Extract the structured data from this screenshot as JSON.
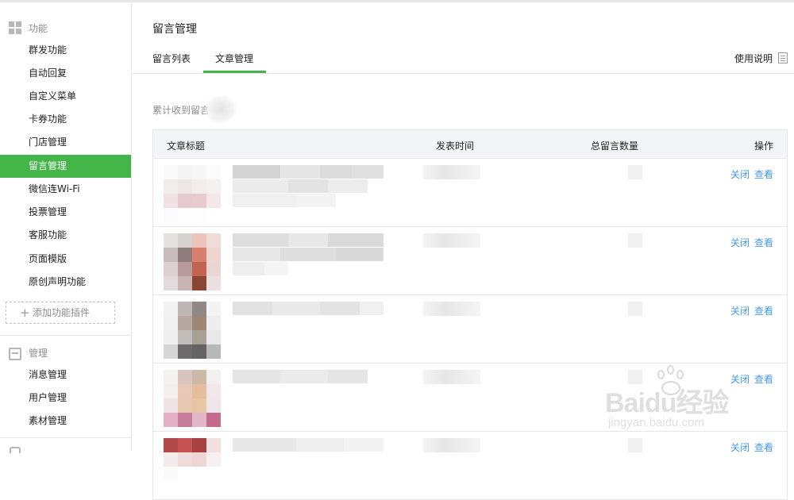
{
  "sidebar": {
    "function_section": {
      "label": "功能",
      "icon": "grid-icon",
      "items": [
        {
          "label": "群发功能"
        },
        {
          "label": "自动回复"
        },
        {
          "label": "自定义菜单"
        },
        {
          "label": "卡券功能"
        },
        {
          "label": "门店管理"
        },
        {
          "label": "留言管理",
          "active": true
        },
        {
          "label": "微信连Wi-Fi"
        },
        {
          "label": "投票管理"
        },
        {
          "label": "客服功能"
        },
        {
          "label": "页面模版"
        },
        {
          "label": "原创声明功能"
        }
      ],
      "add_plugin": {
        "label": "添加功能插件",
        "icon": "plus-icon"
      }
    },
    "manage_section": {
      "label": "管理",
      "icon": "tray-icon",
      "items": [
        {
          "label": "消息管理"
        },
        {
          "label": "用户管理"
        },
        {
          "label": "素材管理"
        }
      ]
    }
  },
  "main": {
    "title": "留言管理",
    "tabs": [
      {
        "label": "留言列表",
        "active": false
      },
      {
        "label": "文章管理",
        "active": true
      }
    ],
    "help": {
      "label": "使用说明",
      "icon": "doc-icon"
    },
    "summary": "累计收到留言",
    "table": {
      "columns": [
        "文章标题",
        "发表时间",
        "总留言数量",
        "操作"
      ],
      "row_actions": {
        "close": "关闭",
        "view": "查看"
      },
      "row_count": 5
    }
  },
  "colors": {
    "accent": "#44b549",
    "link": "#459ae9",
    "border": "#e7e7eb",
    "table_header_bg": "#f4f5f9"
  },
  "watermark": {
    "brand": "Baidu经验",
    "url": "jingyan.baidu.com"
  }
}
